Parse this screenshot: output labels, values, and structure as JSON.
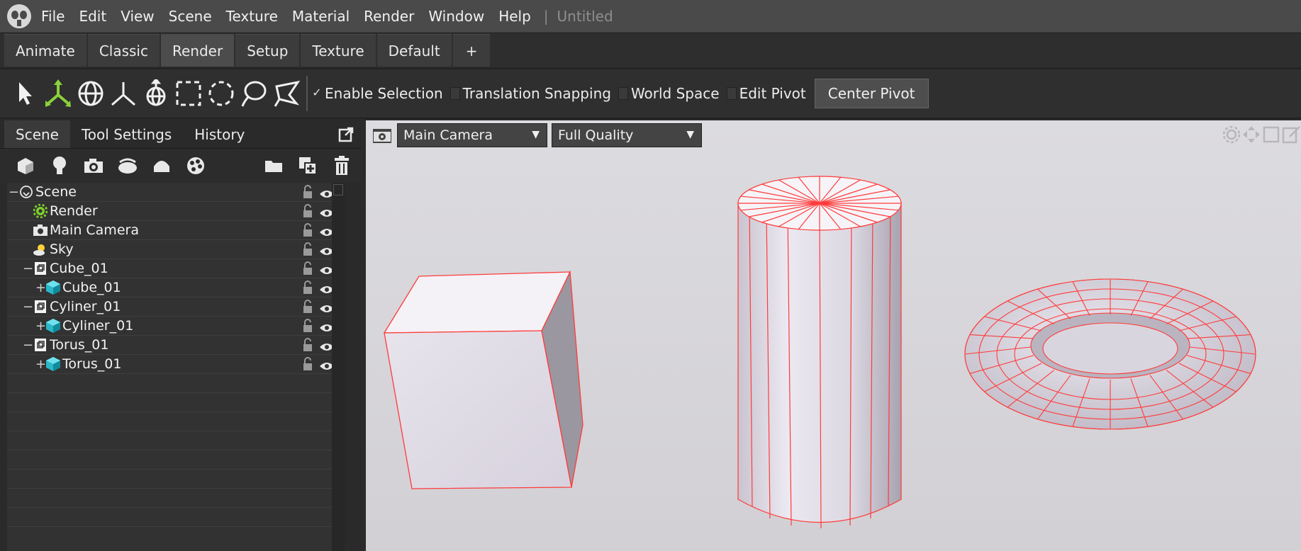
{
  "menubar": {
    "items": [
      "File",
      "Edit",
      "View",
      "Scene",
      "Texture",
      "Material",
      "Render",
      "Window",
      "Help"
    ],
    "separator": "|",
    "doc_title": "Untitled"
  },
  "layout_tabs": [
    "Animate",
    "Classic",
    "Render",
    "Setup",
    "Texture",
    "Default",
    "+"
  ],
  "active_layout_tab": "Render",
  "toolbar": {
    "tools": [
      "select-arrow-icon",
      "move-axes-icon",
      "rotate-globe-icon",
      "scale-axes-icon",
      "pivot-icon",
      "rect-select-icon",
      "circle-select-icon",
      "lasso-select-icon",
      "poly-lasso-icon"
    ],
    "enable_selection": "Enable Selection",
    "enable_selection_checked": true,
    "translation_snapping": "Translation Snapping",
    "world_space": "World Space",
    "edit_pivot": "Edit Pivot",
    "center_pivot": "Center Pivot",
    "check_mark": "✓"
  },
  "left_panel": {
    "tabs": [
      "Scene",
      "Tool Settings",
      "History"
    ],
    "active_tab": "Scene",
    "scene_tree": [
      {
        "label": "Scene",
        "depth": 0,
        "icon": "scene-circle-icon",
        "toggle": "−"
      },
      {
        "label": "Render",
        "depth": 1,
        "icon": "render-gear-icon",
        "toggle": ""
      },
      {
        "label": "Main Camera",
        "depth": 1,
        "icon": "camera-icon",
        "toggle": ""
      },
      {
        "label": "Sky",
        "depth": 1,
        "icon": "sky-sun-icon",
        "toggle": ""
      },
      {
        "label": "Cube_01",
        "depth": 1,
        "icon": "group-node-icon",
        "toggle": "−"
      },
      {
        "label": "Cube_01",
        "depth": 2,
        "icon": "mesh-cube-icon",
        "toggle": "+"
      },
      {
        "label": "Cyliner_01",
        "depth": 1,
        "icon": "group-node-icon",
        "toggle": "−"
      },
      {
        "label": "Cyliner_01",
        "depth": 2,
        "icon": "mesh-cube-icon",
        "toggle": "+"
      },
      {
        "label": "Torus_01",
        "depth": 1,
        "icon": "group-node-icon",
        "toggle": "−"
      },
      {
        "label": "Torus_01",
        "depth": 2,
        "icon": "mesh-cube-icon",
        "toggle": "+"
      }
    ],
    "empty_rows": 8
  },
  "viewport": {
    "camera": "Main Camera",
    "quality": "Full Quality",
    "dropdown_arrow": "▼",
    "background": "#d7d6da",
    "wire_color": "#ff3b3b"
  }
}
